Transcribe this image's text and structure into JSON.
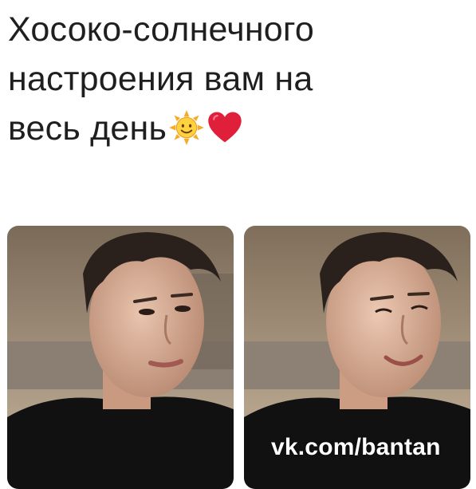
{
  "post": {
    "lines": [
      "Хосоко-солнечного",
      "настроения вам на",
      "весь день"
    ],
    "emojis": [
      "sun-with-face-icon",
      "red-heart-icon"
    ]
  },
  "photos": [
    {
      "name": "photo-left",
      "expression": "neutral"
    },
    {
      "name": "photo-right",
      "expression": "smiling"
    }
  ],
  "watermark": "vk.com/bantan",
  "colors": {
    "text": "#1f1f1f",
    "heart": "#e0203a",
    "sun": "#f7b733"
  }
}
